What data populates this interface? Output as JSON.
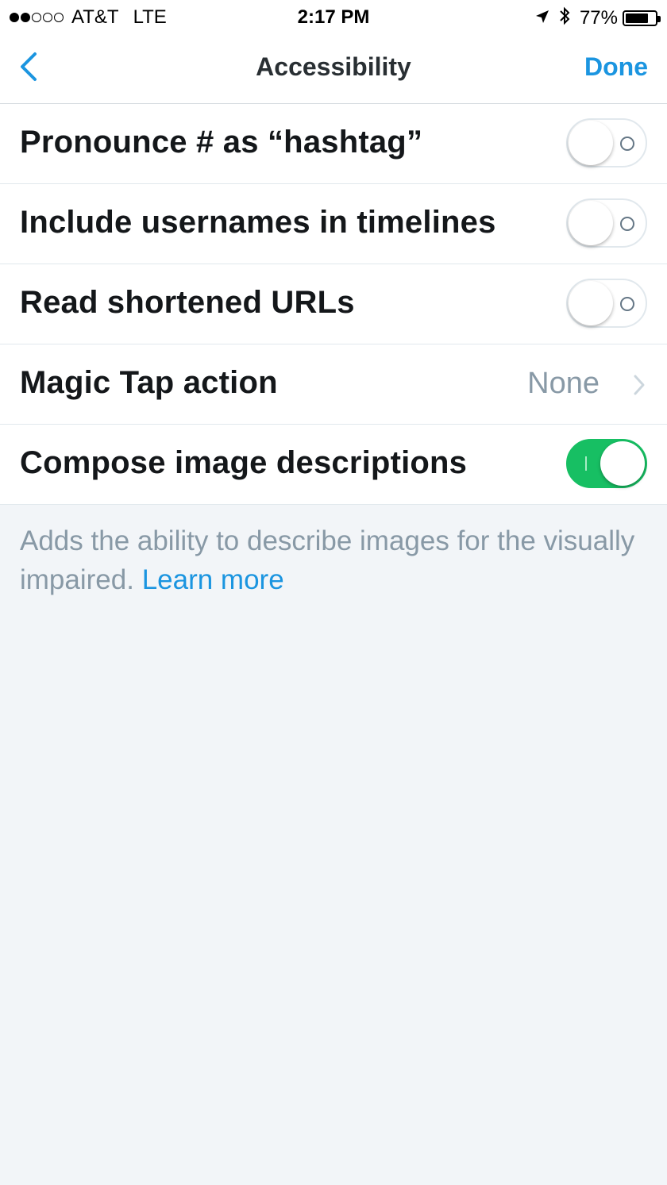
{
  "status_bar": {
    "carrier": "AT&T",
    "network": "LTE",
    "time": "2:17 PM",
    "battery_percent": "77%",
    "battery_level": 0.77,
    "signal_bars_filled": 2,
    "signal_bars_total": 5,
    "icons": [
      "location-arrow-icon",
      "bluetooth-icon",
      "battery-icon"
    ]
  },
  "nav": {
    "back_icon": "chevron-left-icon",
    "title": "Accessibility",
    "done_label": "Done"
  },
  "settings": [
    {
      "label": "Pronounce # as “hashtag”",
      "type": "toggle",
      "enabled": false
    },
    {
      "label": "Include usernames in timelines",
      "type": "toggle",
      "enabled": false
    },
    {
      "label": "Read shortened URLs",
      "type": "toggle",
      "enabled": false
    },
    {
      "label": "Magic Tap action",
      "type": "disclosure",
      "value": "None"
    },
    {
      "label": "Compose image descriptions",
      "type": "toggle",
      "enabled": true
    }
  ],
  "footer": {
    "text": "Adds the ability to describe images for the visually impaired.",
    "link_label": "Learn more"
  },
  "colors": {
    "accent": "#1b95e0",
    "toggle_on": "#17bf63",
    "background": "#f2f5f8",
    "secondary_text": "#8899a6"
  }
}
